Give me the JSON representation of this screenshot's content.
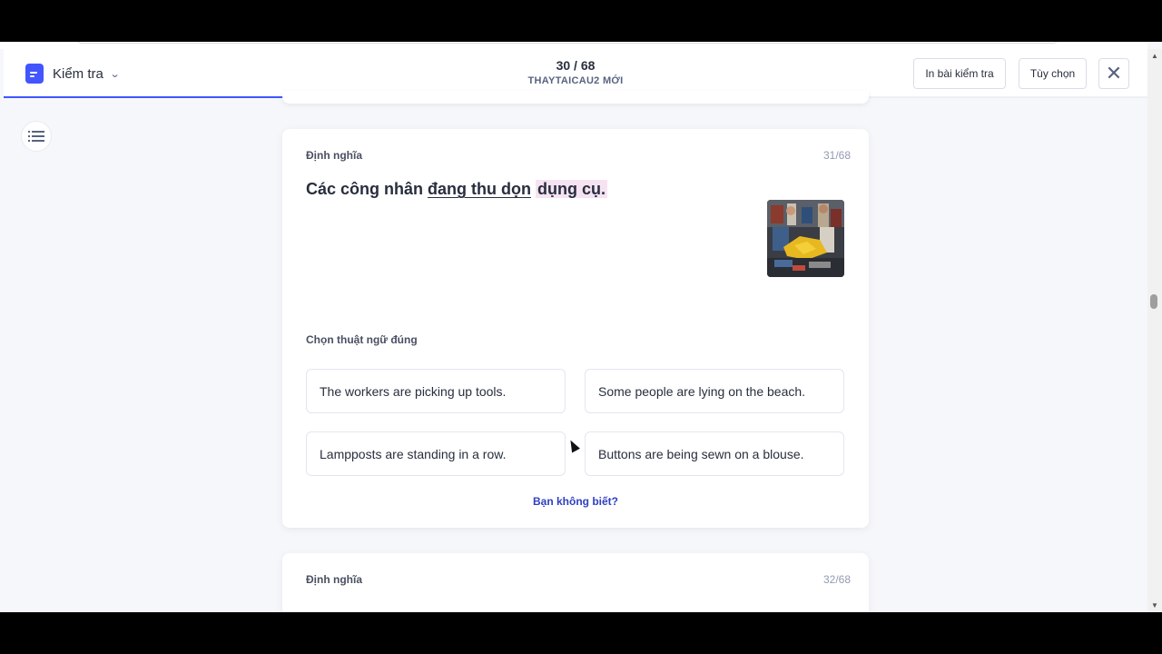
{
  "header": {
    "mode_label": "Kiểm tra",
    "progress_text": "30 / 68",
    "set_name": "THAYTAICAU2 MỚI",
    "print_label": "In bài kiểm tra",
    "options_label": "Tùy chọn",
    "close_glyph": "✕",
    "progress_fraction": 0.4412
  },
  "question": {
    "type_label": "Định nghĩa",
    "number": "31/68",
    "term_plain_1": "Các công nhân ",
    "term_underlined_1": "đang thu dọn",
    "term_space": " ",
    "term_highlighted": "dụng cụ.",
    "image_alt": "Workers gathering tools",
    "prompt": "Chọn thuật ngữ đúng",
    "options": [
      "The workers are picking up tools.",
      "Some people are lying on the beach.",
      "Lampposts are standing in a row.",
      "Buttons are being sewn on a blouse."
    ],
    "dont_know": "Bạn không biết?"
  },
  "next_question": {
    "type_label": "Định nghĩa",
    "number": "32/68"
  },
  "icons": {
    "mode": "document-icon",
    "toc": "list-icon",
    "close": "close-icon",
    "chevron": "chevron-down-icon"
  },
  "colors": {
    "accent": "#4255ff",
    "link": "#3040c0",
    "highlight": "#f6e3f2",
    "background": "#f6f7fb"
  }
}
